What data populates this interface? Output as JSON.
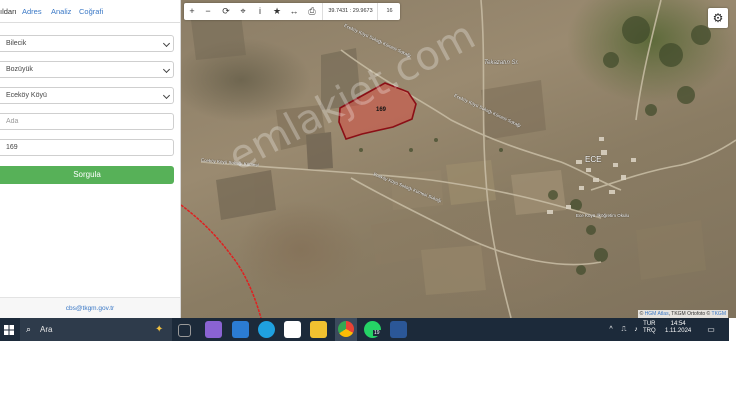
{
  "tabs": [
    "ıldarı",
    "Adres",
    "Analiz",
    "Coğrafi"
  ],
  "form": {
    "province": "Bilecik",
    "district": "Bozüyük",
    "neighborhood": "Eceköy Köyü",
    "block_placeholder": "Ada",
    "parcel_value": "169",
    "query_label": "Sorgula"
  },
  "footer_email": "cbs@tkgm.gov.tr",
  "toolbar": {
    "coordinates": "39.7431 : 29.9673",
    "zoom": "16"
  },
  "map": {
    "parcel_label": "169",
    "village_label": "ECE",
    "labels": [
      "Tekazatın Sr.",
      "Eceköy Köyü Sokağı Kümesi Sokağı",
      "Eceköy Köyü Sokağı Kümesi Sokağı",
      "Eceköy Köyü Sokağı Kümesi",
      "Eceköy Köyü Sokağı Kümesi Sokağı",
      "Ece Köyü İlköğretim Okulu"
    ],
    "watermark": "emlakjet.com",
    "attribution_prefix": "© ",
    "attribution_hgm": "HGM Atlas",
    "attribution_mid": ", TKGM Ortofoto © ",
    "attribution_tkgm": "TKGM"
  },
  "taskbar": {
    "search_label": "Ara",
    "lang_top": "TUR",
    "lang_bottom": "TRQ",
    "time": "14:54",
    "date": "1.11.2024",
    "whatsapp_badge": "19"
  },
  "colors": {
    "button": "#57b158",
    "parcel": "#c0392b",
    "taskbar": "#1c2a3a",
    "link": "#3a78c6"
  }
}
